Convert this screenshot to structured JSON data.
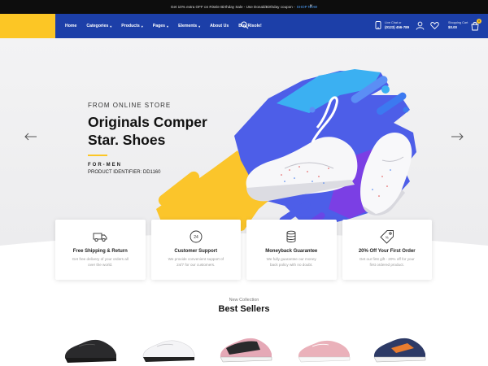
{
  "announcement": {
    "text": "Get 10% extra OFF on Rissle Birthday Sale - Use DonaldBirthday coupon -",
    "link": "SHOP NOW",
    "close": "×"
  },
  "header": {
    "nav": [
      {
        "label": "Home",
        "dropdown": false
      },
      {
        "label": "Categories",
        "dropdown": true
      },
      {
        "label": "Products",
        "dropdown": true
      },
      {
        "label": "Pages",
        "dropdown": true
      },
      {
        "label": "Elements",
        "dropdown": true
      },
      {
        "label": "About Us",
        "dropdown": false
      },
      {
        "label": "Buy Risole!",
        "dropdown": false
      }
    ],
    "contact": {
      "label": "Live Chat or",
      "phone": "(0123) 456-789"
    },
    "cart": {
      "label": "Shopping Cart",
      "amount": "$0.00",
      "count": "0"
    },
    "colors": {
      "bar": "#1c3fa8",
      "accent": "#fcc625"
    }
  },
  "hero": {
    "eyebrow": "FROM ONLINE STORE",
    "headline_line1": "Originals Comper",
    "headline_line2": "Star. Shoes",
    "tag": "FOR-MEN",
    "product_id": "PRODUCT IDENTIFIER: DD1160"
  },
  "features": [
    {
      "icon": "truck-icon",
      "title": "Free Shipping & Return",
      "desc": "Get free delivery of your orders all over the world."
    },
    {
      "icon": "support-24-icon",
      "title": "Customer Support",
      "desc": "We provide convenient support of 24/7 for our customers."
    },
    {
      "icon": "money-stack-icon",
      "title": "Moneyback Guarantee",
      "desc": "We fully guarantee our money back policy with no doubt."
    },
    {
      "icon": "tag-icon",
      "title": "20% Off Your First Order",
      "desc": "Get our first gift - 20% off for your first ordered product."
    }
  ],
  "collection": {
    "subtitle": "New Collection",
    "title": "Best Sellers"
  },
  "products": [
    {
      "name": "black-sneaker"
    },
    {
      "name": "white-sneaker"
    },
    {
      "name": "pink-black-sneaker"
    },
    {
      "name": "pink-sneaker"
    },
    {
      "name": "navy-orange-sneaker"
    }
  ]
}
